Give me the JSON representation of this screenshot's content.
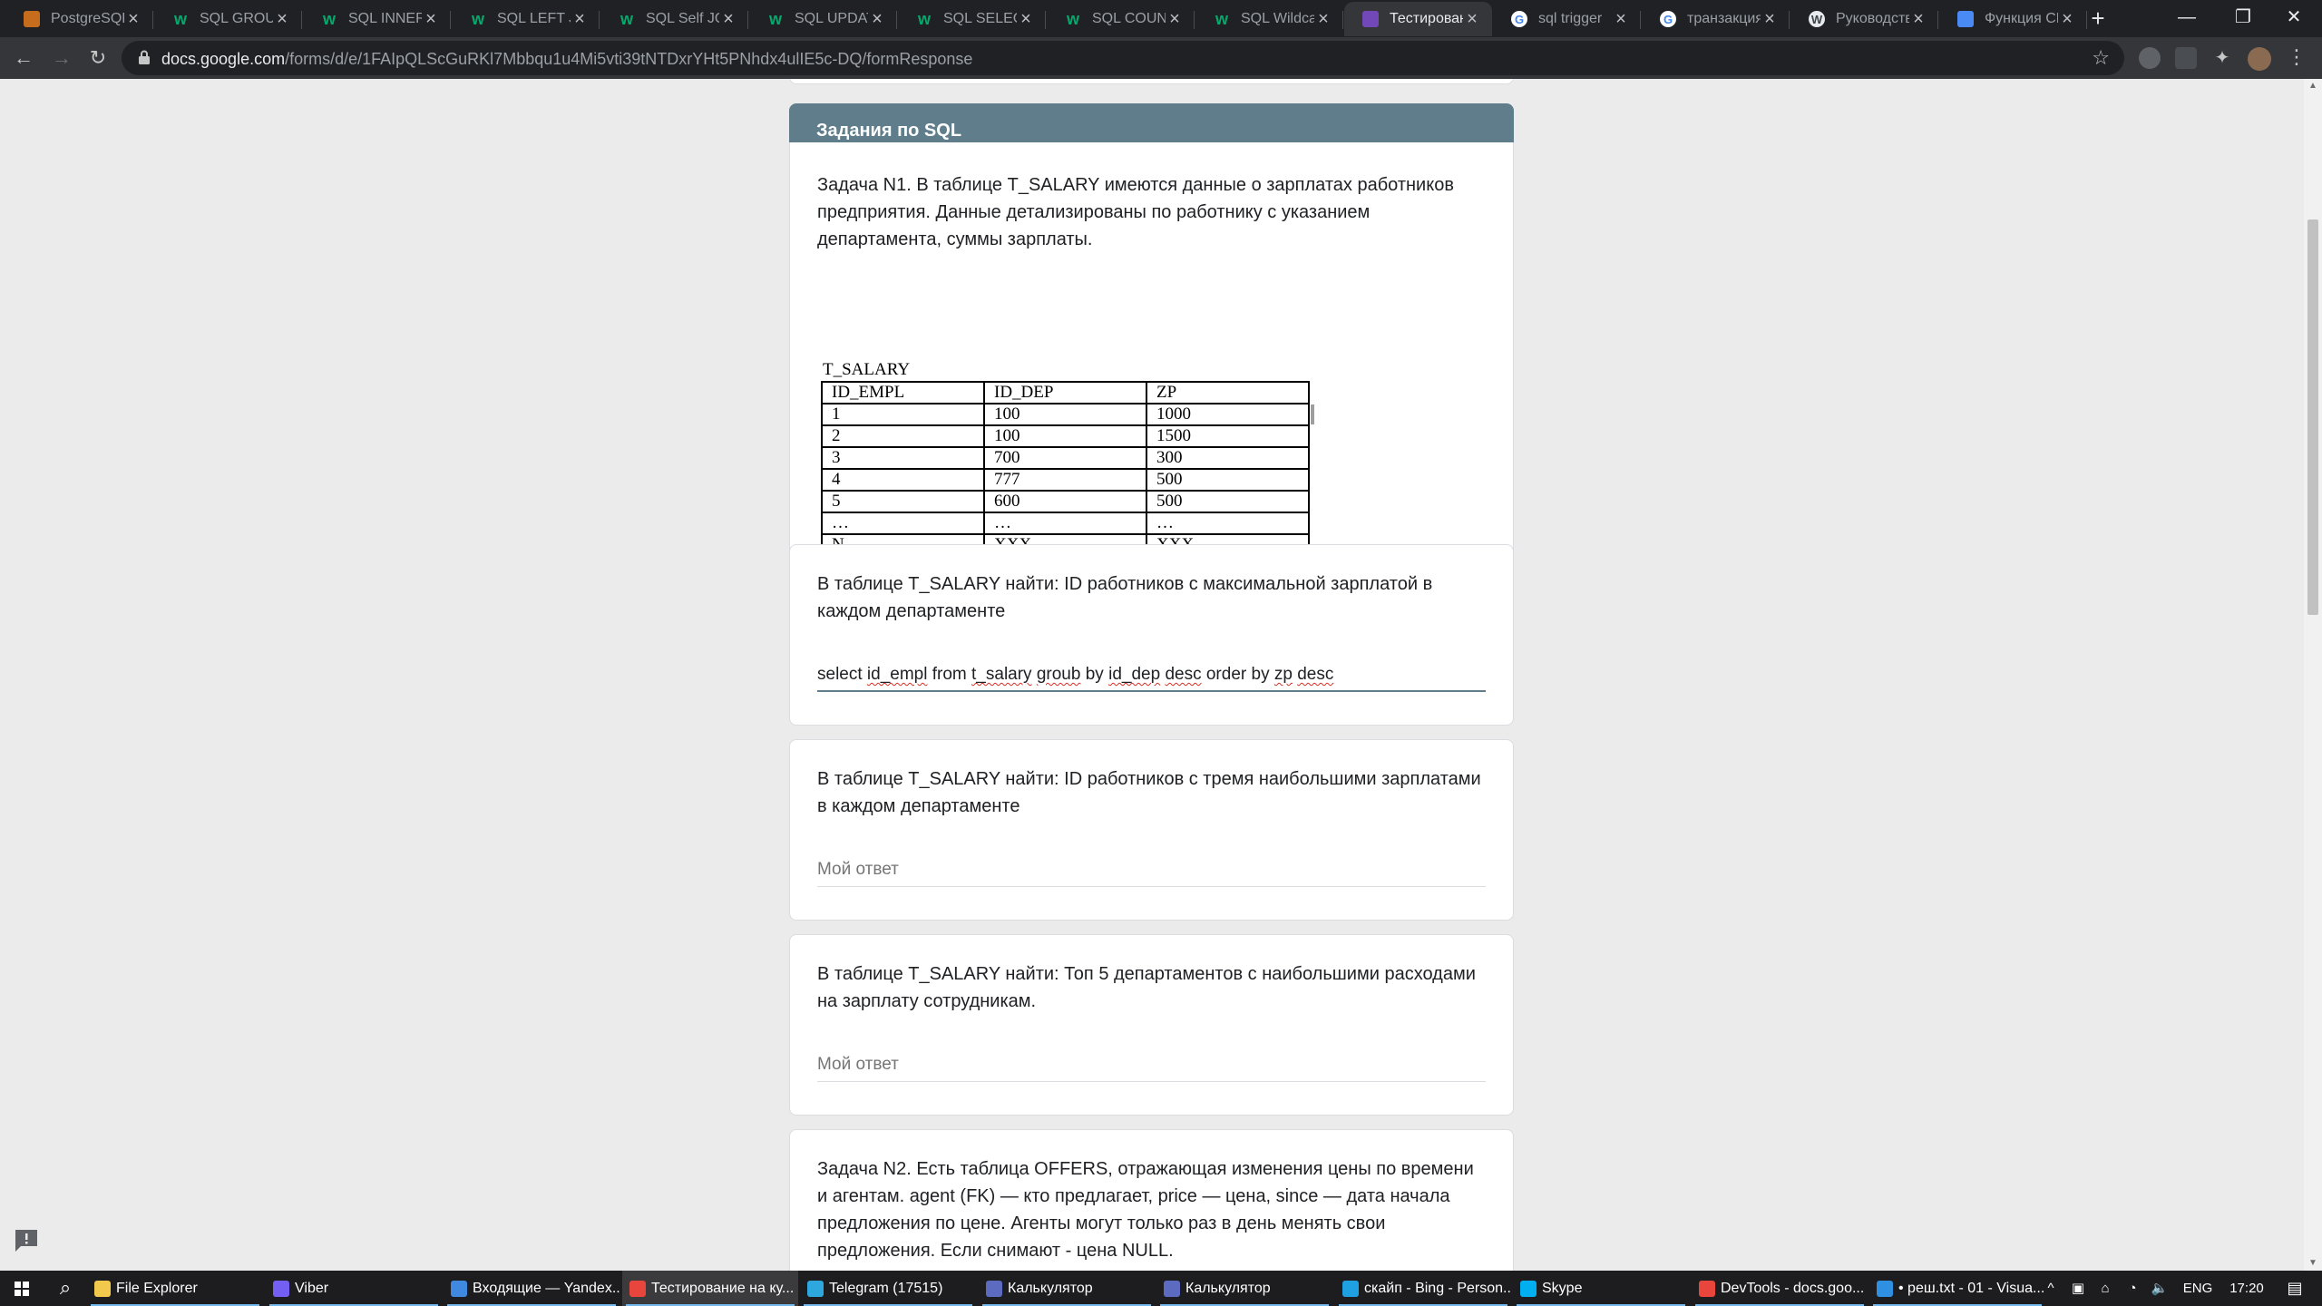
{
  "browser": {
    "tabs": [
      {
        "title": "PostgreSQL",
        "icon": "postgres-icon"
      },
      {
        "title": "SQL GROUP",
        "icon": "w3schools-icon"
      },
      {
        "title": "SQL INNER",
        "icon": "w3schools-icon"
      },
      {
        "title": "SQL LEFT JO",
        "icon": "w3schools-icon"
      },
      {
        "title": "SQL Self JOI",
        "icon": "w3schools-icon"
      },
      {
        "title": "SQL UPDATE",
        "icon": "w3schools-icon"
      },
      {
        "title": "SQL SELECT",
        "icon": "w3schools-icon"
      },
      {
        "title": "SQL COUNT",
        "icon": "w3schools-icon"
      },
      {
        "title": "SQL Wildcar",
        "icon": "w3schools-icon"
      },
      {
        "title": "Тестирован",
        "icon": "google-forms-icon",
        "active": true
      },
      {
        "title": "sql trigger",
        "icon": "google-icon"
      },
      {
        "title": "транзакция",
        "icon": "google-icon"
      },
      {
        "title": "Руководств",
        "icon": "wordpress-icon"
      },
      {
        "title": "Функция CE",
        "icon": "doc-icon"
      }
    ],
    "url_host": "docs.google.com",
    "url_path": "/forms/d/e/1FAIpQLScGuRKl7Mbbqu1u4Mi5vti39tNTDxrYHt5PNhdx4ulIE5c-DQ/formResponse"
  },
  "form": {
    "section_title": "Задания по SQL",
    "task1_text": "Задача N1. В таблице T_SALARY имеются данные о зарплатах работников предприятия. Данные детализированы по работнику с указанием департамента, суммы зарплаты.",
    "table_caption": "T_SALARY",
    "table_rows": [
      [
        "ID_EMPL",
        "ID_DEP",
        "ZP"
      ],
      [
        "1",
        "100",
        "1000"
      ],
      [
        "2",
        "100",
        "1500"
      ],
      [
        "3",
        "700",
        "300"
      ],
      [
        "4",
        "777",
        "500"
      ],
      [
        "5",
        "600",
        "500"
      ],
      [
        "…",
        "…",
        "…"
      ],
      [
        "N",
        "XXX",
        "XXX"
      ]
    ],
    "q1_text": "В таблице T_SALARY найти: ID работников с максимальной зарплатой в каждом департаменте",
    "q1_answer_words": [
      {
        "w": "select",
        "sq": false
      },
      {
        "w": "id_empl",
        "sq": true
      },
      {
        "w": "from",
        "sq": false
      },
      {
        "w": "t_salary",
        "sq": true
      },
      {
        "w": "groub",
        "sq": true
      },
      {
        "w": "by",
        "sq": false
      },
      {
        "w": "id_dep",
        "sq": true
      },
      {
        "w": "desc",
        "sq": true
      },
      {
        "w": "order",
        "sq": false
      },
      {
        "w": "by",
        "sq": false
      },
      {
        "w": "zp",
        "sq": true
      },
      {
        "w": "desc",
        "sq": true
      }
    ],
    "q2_text": "В таблице T_SALARY найти: ID работников с тремя наибольшими зарплатами в каждом департаменте",
    "q3_text": "В таблице T_SALARY найти: Топ 5 департаментов с наибольшими расходами на зарплату сотрудникам.",
    "answer_placeholder": "Мой ответ",
    "task2_text": "Задача N2. Есть таблица OFFERS, отражающая изменения цены по времени и агентам. agent (FK) — кто предлагает, price — цена, since — дата начала предложения по цене. Агенты могут только раз в день менять свои предложения. Если снимают - цена NULL."
  },
  "taskbar": {
    "items": [
      {
        "label": "File Explorer",
        "icon": "folder-icon",
        "color": "#f2c94c"
      },
      {
        "label": "Viber",
        "icon": "viber-icon",
        "color": "#7360f2"
      },
      {
        "label": "Входящие — Yandex...",
        "icon": "mail-icon",
        "color": "#3f8ae0"
      },
      {
        "label": "Тестирование на ку...",
        "icon": "chrome-icon",
        "color": "#e8453c",
        "active": true
      },
      {
        "label": "Telegram (17515)",
        "icon": "telegram-icon",
        "color": "#2ea6de"
      },
      {
        "label": "Калькулятор",
        "icon": "calculator-icon",
        "color": "#5c6bc0"
      },
      {
        "label": "Калькулятор",
        "icon": "calculator-icon",
        "color": "#5c6bc0"
      },
      {
        "label": "скайп - Bing - Person...",
        "icon": "edge-icon",
        "color": "#1fa0e0"
      },
      {
        "label": "Skype",
        "icon": "skype-icon",
        "color": "#00aff0"
      },
      {
        "label": "DevTools - docs.goo...",
        "icon": "chrome-icon",
        "color": "#e8453c"
      },
      {
        "label": "• реш.txt - 01 - Visua...",
        "icon": "vscode-icon",
        "color": "#2f8fe0"
      }
    ],
    "lang": "ENG",
    "time": "17:20"
  },
  "colors": {
    "section_header": "#607d8b",
    "page_bg": "#ebebeb",
    "tabstrip": "#202124",
    "toolbar": "#35363a"
  }
}
